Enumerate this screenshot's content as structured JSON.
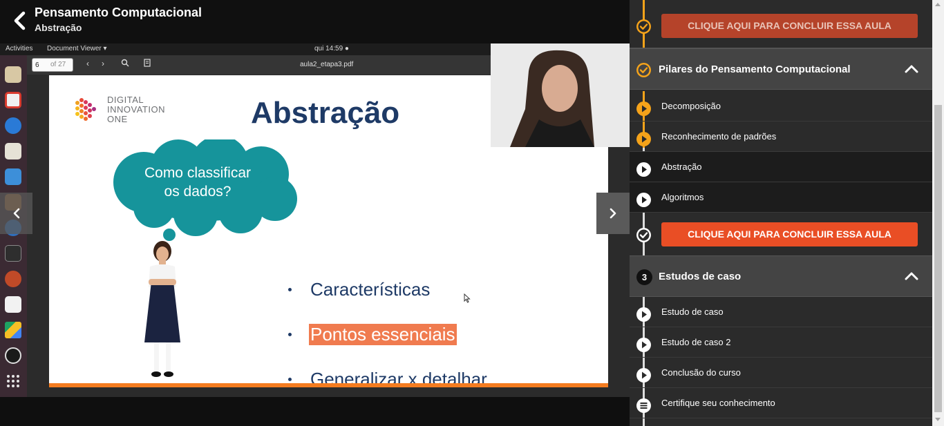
{
  "header": {
    "course_title": "Pensamento Computacional",
    "lesson_title": "Abstração"
  },
  "desktop": {
    "activities": "Activities",
    "app_name": "Document Viewer ▾",
    "clock": "qui 14:59 ●",
    "page_value": "6",
    "page_of": "of 27",
    "file_name": "aula2_etapa3.pdf"
  },
  "slide": {
    "brand_line1": "DIGITAL",
    "brand_line2": "INNOVATION",
    "brand_line3": "ONE",
    "title": "Abstração",
    "cloud_line1": "Como classificar",
    "cloud_line2": "os dados?",
    "bullets": [
      "Características",
      "Pontos essenciais",
      "Generalizar x detalhar"
    ],
    "highlight_color": "#f07b4f",
    "title_color": "#1e3a66",
    "cloud_color": "#16949b"
  },
  "sidebar": {
    "accent": "#f5a31a",
    "button_active_color": "#e94e25",
    "button_dim_color": "#b5432a",
    "complete_label_top": "CLIQUE AQUI PARA CONCLUIR ESSA AULA",
    "section2": {
      "title": "Pilares do Pensamento Computacional",
      "items": [
        "Decomposição",
        "Reconhecimento de padrões",
        "Abstração",
        "Algoritmos"
      ],
      "complete_label": "CLIQUE AQUI PARA CONCLUIR ESSA AULA"
    },
    "section3": {
      "number": "3",
      "title": "Estudos de caso",
      "items": [
        "Estudo de caso",
        "Estudo de caso 2",
        "Conclusão do curso",
        "Certifique seu conhecimento"
      ]
    }
  }
}
